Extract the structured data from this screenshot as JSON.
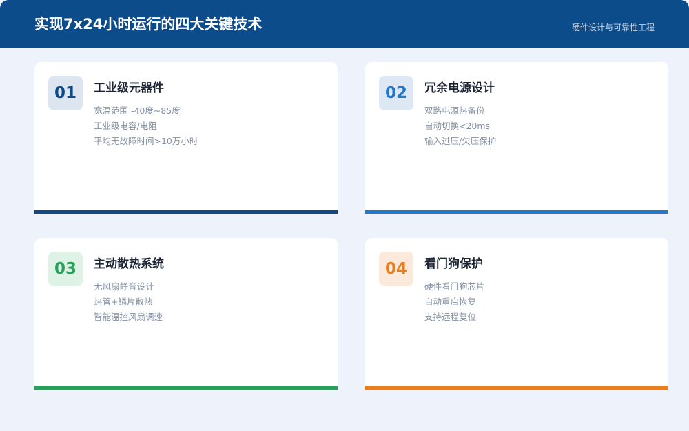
{
  "header": {
    "title": "实现7x24小时运行的四大关键技术",
    "subtitle": "硬件设计与可靠性工程"
  },
  "colors": {
    "header_bg": "#0d4c8b",
    "page_bg": "#eef2fa"
  },
  "cards": [
    {
      "number": "01",
      "title": "工业级元器件",
      "items": [
        "宽温范围 -40度~85度",
        "工业级电容/电阻",
        "平均无故障时间>10万小时"
      ],
      "accent": "#0d4c8b",
      "badge_bg": "#dde5f0"
    },
    {
      "number": "02",
      "title": "冗余电源设计",
      "items": [
        "双路电源热备份",
        "自动切换<20ms",
        "输入过压/欠压保护"
      ],
      "accent": "#1f78cc",
      "badge_bg": "#dde8f4"
    },
    {
      "number": "03",
      "title": "主动散热系统",
      "items": [
        "无风扇静音设计",
        "热管+鳞片散热",
        "智能温控风扇调速"
      ],
      "accent": "#2aa05c",
      "badge_bg": "#def3e6"
    },
    {
      "number": "04",
      "title": "看门狗保护",
      "items": [
        "硬件看门狗芯片",
        "自动重启恢复",
        "支持远程复位"
      ],
      "accent": "#e67e22",
      "badge_bg": "#fbeadb"
    }
  ]
}
